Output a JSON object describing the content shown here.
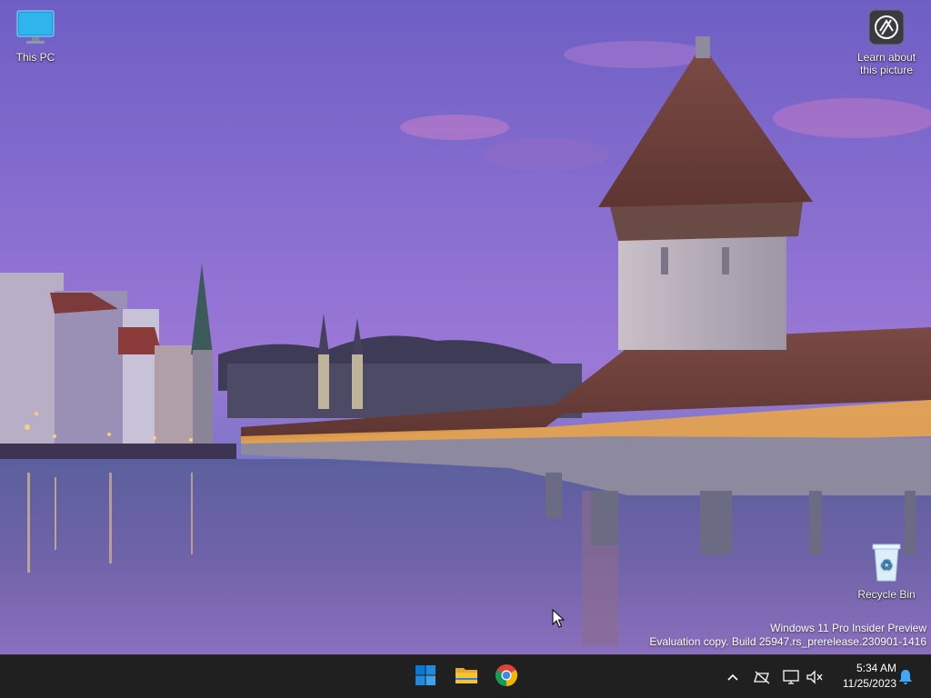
{
  "desktop": {
    "icons": [
      {
        "label": "This PC",
        "icon": "monitor-icon"
      },
      {
        "label": "Learn about\nthis picture",
        "icon": "camera-icon"
      },
      {
        "label": "Recycle Bin",
        "icon": "recycle-bin-icon"
      }
    ]
  },
  "watermark": {
    "line1": "Windows 11 Pro Insider Preview",
    "line2": "Evaluation copy. Build 25947.rs_prerelease.230901-1416"
  },
  "taskbar": {
    "pinned": [
      {
        "name": "Start",
        "icon": "windows-start-icon"
      },
      {
        "name": "File Explorer",
        "icon": "folder-icon"
      },
      {
        "name": "Google Chrome",
        "icon": "chrome-icon"
      }
    ],
    "tray": {
      "icons": [
        "chevron-up-icon",
        "network-offline-icon",
        "display-icon",
        "volume-muted-icon",
        "notification-bell-icon"
      ],
      "time": "5:34 AM",
      "date": "11/25/2023"
    }
  },
  "colors": {
    "taskbar_bg": "#202020",
    "start_blue": "#0a78d4",
    "folder_yellow": "#f2c530",
    "bell_blue": "#3fa9f5"
  }
}
